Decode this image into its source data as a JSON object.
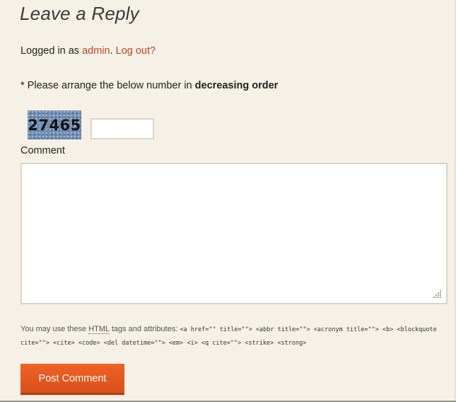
{
  "reply": {
    "title": "Leave a Reply",
    "logged_in_prefix": "Logged in as ",
    "user_link": "admin",
    "separator": ". ",
    "logout_link": "Log out?"
  },
  "captcha": {
    "instruction_prefix": "* Please arrange the below number in ",
    "instruction_bold": "decreasing order",
    "image_text": "27465",
    "answer_value": ""
  },
  "comment": {
    "label": "Comment",
    "value": ""
  },
  "allowed_tags": {
    "prefix": "You may use these ",
    "abbr": "HTML",
    "suffix": " tags and attributes: ",
    "code": "<a href=\"\" title=\"\"> <abbr title=\"\"> <acronym title=\"\"> <b> <blockquote cite=\"\"> <cite> <code> <del datetime=\"\"> <em> <i> <q cite=\"\"> <strike> <strong>"
  },
  "submit": {
    "label": "Post Comment"
  },
  "colors": {
    "background": "#f5f1e6",
    "link": "#c0441f",
    "button": "#e4571f",
    "field_border": "#d9d6c4"
  },
  "icons": {
    "resize_grip": "resize-grip-icon"
  }
}
